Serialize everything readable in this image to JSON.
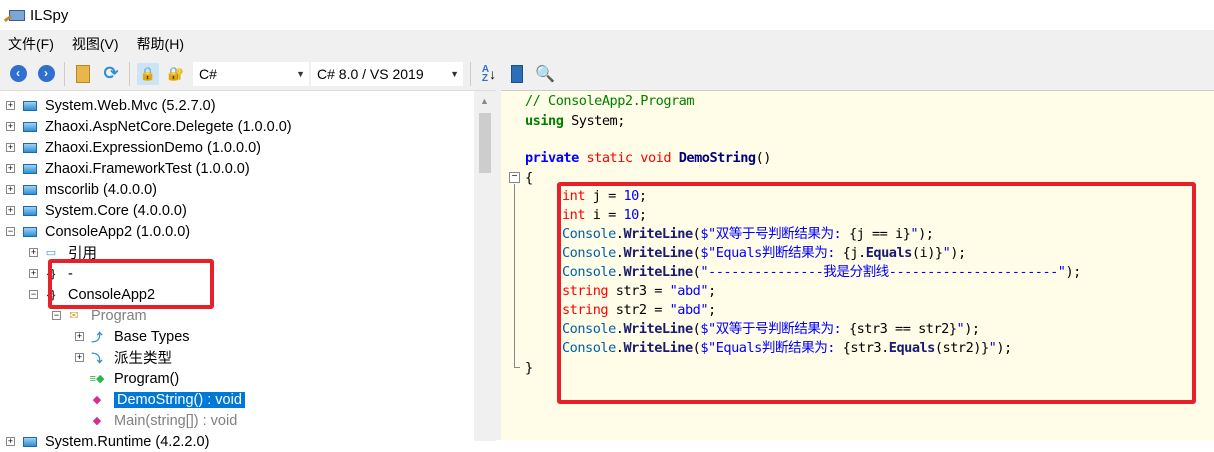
{
  "window": {
    "title": "ILSpy"
  },
  "menu": [
    "文件(F)",
    "视图(V)",
    "帮助(H)"
  ],
  "toolbar": {
    "language": "C#",
    "version": "C# 8.0 / VS 2019"
  },
  "tree": [
    {
      "label": "System.Web.Mvc (5.2.7.0)",
      "level": 0,
      "expander": "+",
      "icon": "assembly-icon"
    },
    {
      "label": "Zhaoxi.AspNetCore.Delegete (1.0.0.0)",
      "level": 0,
      "expander": "+",
      "icon": "assembly-icon"
    },
    {
      "label": "Zhaoxi.ExpressionDemo (1.0.0.0)",
      "level": 0,
      "expander": "+",
      "icon": "assembly-icon"
    },
    {
      "label": "Zhaoxi.FrameworkTest (1.0.0.0)",
      "level": 0,
      "expander": "+",
      "icon": "assembly-icon"
    },
    {
      "label": "mscorlib (4.0.0.0)",
      "level": 0,
      "expander": "+",
      "icon": "assembly-icon"
    },
    {
      "label": "System.Core (4.0.0.0)",
      "level": 0,
      "expander": "+",
      "icon": "assembly-icon"
    },
    {
      "label": "ConsoleApp2 (1.0.0.0)",
      "level": 0,
      "expander": "-",
      "icon": "assembly-icon"
    },
    {
      "label": "引用",
      "level": 1,
      "expander": "+",
      "icon": "references-icon"
    },
    {
      "label": "-",
      "level": 1,
      "expander": "+",
      "icon": "namespace-icon"
    },
    {
      "label": "ConsoleApp2",
      "level": 1,
      "expander": "-",
      "icon": "namespace-icon"
    },
    {
      "label": "Program",
      "level": 2,
      "expander": "-",
      "icon": "class-icon",
      "gray": true
    },
    {
      "label": "Base Types",
      "level": 3,
      "expander": "+",
      "icon": "base-types-icon"
    },
    {
      "label": "派生类型",
      "level": 3,
      "expander": "+",
      "icon": "derived-types-icon"
    },
    {
      "label": "Program()",
      "level": 3,
      "expander": "",
      "icon": "constructor-icon"
    },
    {
      "label": "DemoString() : void",
      "level": 3,
      "expander": "",
      "icon": "method-icon",
      "selected": true
    },
    {
      "label": "Main(string[]) : void",
      "level": 3,
      "expander": "",
      "icon": "method-icon",
      "gray": true
    },
    {
      "label": "System.Runtime (4.2.2.0)",
      "level": 0,
      "expander": "+",
      "icon": "assembly-icon"
    }
  ],
  "code": [
    {
      "indent": 0,
      "tokens": [
        [
          "cm",
          "// ConsoleApp2.Program"
        ]
      ]
    },
    {
      "indent": 0,
      "tokens": [
        [
          "using",
          "using"
        ],
        [
          "pl",
          " System;"
        ]
      ]
    },
    {
      "indent": 0,
      "tokens": []
    },
    {
      "indent": 0,
      "tokens": [
        [
          "kwb",
          "private"
        ],
        [
          "pl",
          " "
        ],
        [
          "red",
          "static"
        ],
        [
          "pl",
          " "
        ],
        [
          "red",
          "void"
        ],
        [
          "pl",
          " "
        ],
        [
          "bold",
          "DemoString"
        ],
        [
          "pl",
          "()"
        ]
      ]
    },
    {
      "indent": 0,
      "tokens": [
        [
          "pl",
          "{"
        ]
      ]
    },
    {
      "indent": 1,
      "tokens": [
        [
          "red",
          "int"
        ],
        [
          "pl",
          " j = "
        ],
        [
          "num",
          "10"
        ],
        [
          "pl",
          ";"
        ]
      ]
    },
    {
      "indent": 1,
      "tokens": [
        [
          "red",
          "int"
        ],
        [
          "pl",
          " i = "
        ],
        [
          "num",
          "10"
        ],
        [
          "pl",
          ";"
        ]
      ]
    },
    {
      "indent": 1,
      "tokens": [
        [
          "type",
          "Console"
        ],
        [
          "pl",
          "."
        ],
        [
          "mb",
          "WriteLine"
        ],
        [
          "pl",
          "("
        ],
        [
          "str",
          "$\"双等于号判断结果为: "
        ],
        [
          "pl",
          "{j == i}"
        ],
        [
          "str",
          "\""
        ],
        [
          "pl",
          ");"
        ]
      ]
    },
    {
      "indent": 1,
      "tokens": [
        [
          "type",
          "Console"
        ],
        [
          "pl",
          "."
        ],
        [
          "mb",
          "WriteLine"
        ],
        [
          "pl",
          "("
        ],
        [
          "str",
          "$\"Equals判断结果为: "
        ],
        [
          "pl",
          "{j."
        ],
        [
          "mb",
          "Equals"
        ],
        [
          "pl",
          "(i)}"
        ],
        [
          "str",
          "\""
        ],
        [
          "pl",
          ");"
        ]
      ]
    },
    {
      "indent": 1,
      "tokens": [
        [
          "type",
          "Console"
        ],
        [
          "pl",
          "."
        ],
        [
          "mb",
          "WriteLine"
        ],
        [
          "pl",
          "("
        ],
        [
          "str",
          "\"---------------我是分割线----------------------\""
        ],
        [
          "pl",
          ");"
        ]
      ]
    },
    {
      "indent": 1,
      "tokens": [
        [
          "red",
          "string"
        ],
        [
          "pl",
          " str3 = "
        ],
        [
          "str",
          "\"abd\""
        ],
        [
          "pl",
          ";"
        ]
      ]
    },
    {
      "indent": 1,
      "tokens": [
        [
          "red",
          "string"
        ],
        [
          "pl",
          " str2 = "
        ],
        [
          "str",
          "\"abd\""
        ],
        [
          "pl",
          ";"
        ]
      ]
    },
    {
      "indent": 1,
      "tokens": [
        [
          "type",
          "Console"
        ],
        [
          "pl",
          "."
        ],
        [
          "mb",
          "WriteLine"
        ],
        [
          "pl",
          "("
        ],
        [
          "str",
          "$\"双等于号判断结果为: "
        ],
        [
          "pl",
          "{str3 == str2}"
        ],
        [
          "str",
          "\""
        ],
        [
          "pl",
          ");"
        ]
      ]
    },
    {
      "indent": 1,
      "tokens": [
        [
          "type",
          "Console"
        ],
        [
          "pl",
          "."
        ],
        [
          "mb",
          "WriteLine"
        ],
        [
          "pl",
          "("
        ],
        [
          "str",
          "$\"Equals判断结果为: "
        ],
        [
          "pl",
          "{str3."
        ],
        [
          "mb",
          "Equals"
        ],
        [
          "pl",
          "(str2)}"
        ],
        [
          "str",
          "\""
        ],
        [
          "pl",
          ");"
        ]
      ]
    },
    {
      "indent": 0,
      "tokens": [
        [
          "pl",
          "}"
        ]
      ]
    }
  ],
  "colors": {
    "highlight": "#e8202a",
    "selection": "#0078d7",
    "code_bg": "#fffde8"
  }
}
